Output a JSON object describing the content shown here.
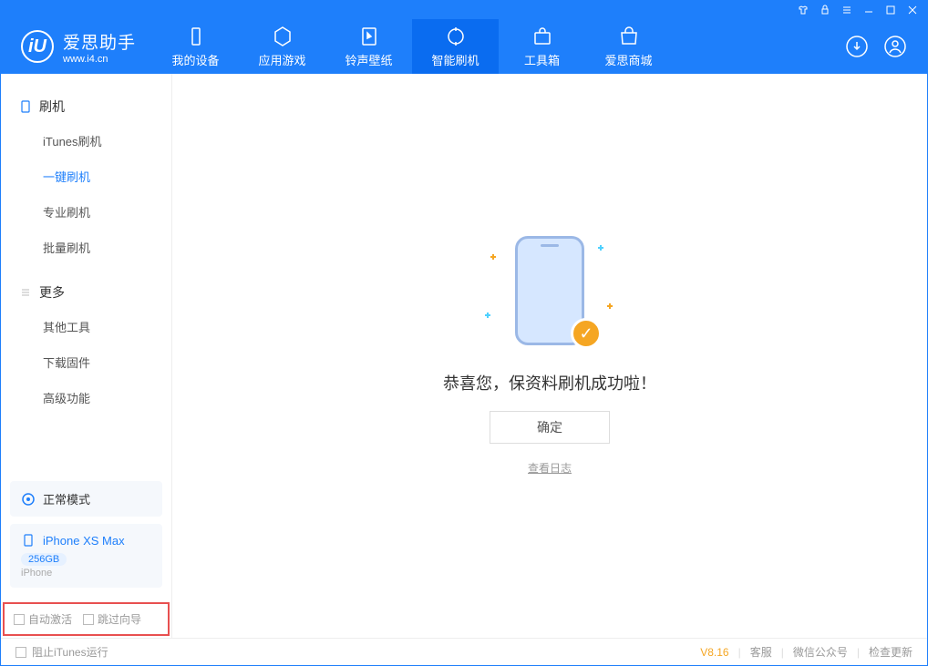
{
  "app": {
    "name": "爱思助手",
    "url": "www.i4.cn"
  },
  "tabs": [
    {
      "label": "我的设备"
    },
    {
      "label": "应用游戏"
    },
    {
      "label": "铃声壁纸"
    },
    {
      "label": "智能刷机"
    },
    {
      "label": "工具箱"
    },
    {
      "label": "爱思商城"
    }
  ],
  "sidebar": {
    "sec1": "刷机",
    "items1": [
      {
        "label": "iTunes刷机"
      },
      {
        "label": "一键刷机"
      },
      {
        "label": "专业刷机"
      },
      {
        "label": "批量刷机"
      }
    ],
    "sec2": "更多",
    "items2": [
      {
        "label": "其他工具"
      },
      {
        "label": "下载固件"
      },
      {
        "label": "高级功能"
      }
    ]
  },
  "mode": {
    "label": "正常模式"
  },
  "device": {
    "name": "iPhone XS Max",
    "storage": "256GB",
    "type": "iPhone"
  },
  "options": {
    "auto": "自动激活",
    "skip": "跳过向导"
  },
  "main": {
    "message": "恭喜您，保资料刷机成功啦！",
    "ok": "确定",
    "log": "查看日志"
  },
  "status": {
    "block": "阻止iTunes运行",
    "version": "V8.16",
    "support": "客服",
    "wechat": "微信公众号",
    "update": "检查更新"
  }
}
